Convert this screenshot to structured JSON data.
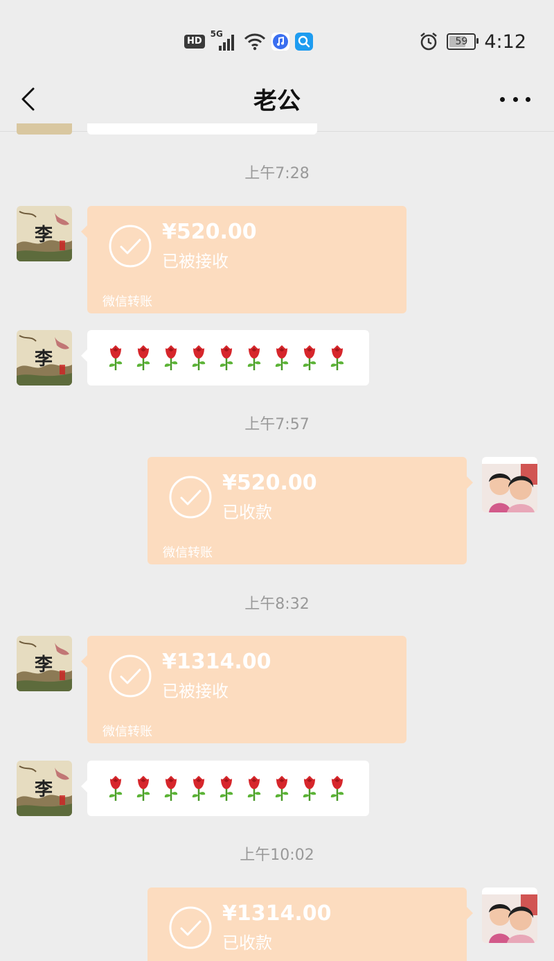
{
  "status_bar": {
    "hd": "HD",
    "network": "5G",
    "battery": "59",
    "time": "4:12"
  },
  "header": {
    "title": "老公"
  },
  "messages": [
    {
      "type": "timestamp",
      "text": "上午7:28"
    },
    {
      "type": "transfer",
      "side": "left",
      "amount": "¥520.00",
      "status": "已被接收",
      "footer": "微信转账"
    },
    {
      "type": "emoji",
      "side": "left",
      "emoji": "rose-emoji",
      "count": 9
    },
    {
      "type": "timestamp",
      "text": "上午7:57"
    },
    {
      "type": "transfer",
      "side": "right",
      "amount": "¥520.00",
      "status": "已收款",
      "footer": "微信转账"
    },
    {
      "type": "timestamp",
      "text": "上午8:32"
    },
    {
      "type": "transfer",
      "side": "left",
      "amount": "¥1314.00",
      "status": "已被接收",
      "footer": "微信转账"
    },
    {
      "type": "emoji",
      "side": "left",
      "emoji": "rose-emoji",
      "count": 9
    },
    {
      "type": "timestamp",
      "text": "上午10:02"
    },
    {
      "type": "transfer",
      "side": "right",
      "amount": "¥1314.00",
      "status": "已收款",
      "footer": ""
    }
  ],
  "colors": {
    "background": "#ededed",
    "transfer_bubble": "#fcdcbf",
    "text_bubble": "#ffffff"
  }
}
